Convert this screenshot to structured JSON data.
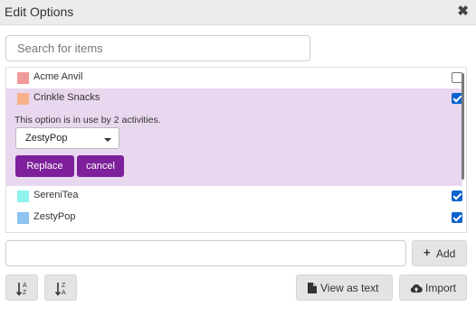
{
  "dialog": {
    "title": "Edit Options",
    "close_glyph": "✖"
  },
  "search": {
    "placeholder": "Search for items",
    "value": ""
  },
  "items": [
    {
      "label": "Acme Anvil",
      "color": "#f19a9a",
      "checked": false
    },
    {
      "label": "Crinkle Snacks",
      "color": "#f7b08a",
      "checked": true
    },
    {
      "label": "SereniTea",
      "color": "#8ff3ee",
      "checked": true
    },
    {
      "label": "ZestyPop",
      "color": "#8cc3f0",
      "checked": true
    }
  ],
  "replace_panel": {
    "message": "This option is in use by 2 activities.",
    "select_value": "ZestyPop",
    "replace_label": "Replace",
    "cancel_label": "cancel",
    "accent_color": "#7e1f9b"
  },
  "add": {
    "value": "",
    "button_label": "Add",
    "button_icon": "plus-icon"
  },
  "footer": {
    "sort_asc_icon": "sort-alpha-asc-icon",
    "sort_desc_icon": "sort-alpha-desc-icon",
    "view_as_text_label": "View as text",
    "view_as_text_icon": "file-icon",
    "import_label": "Import",
    "import_icon": "cloud-upload-icon"
  },
  "colors": {
    "header_bg": "#ececec",
    "checkbox_blue": "#0b63cd",
    "selected_row_bg": "#e8d7ef"
  }
}
